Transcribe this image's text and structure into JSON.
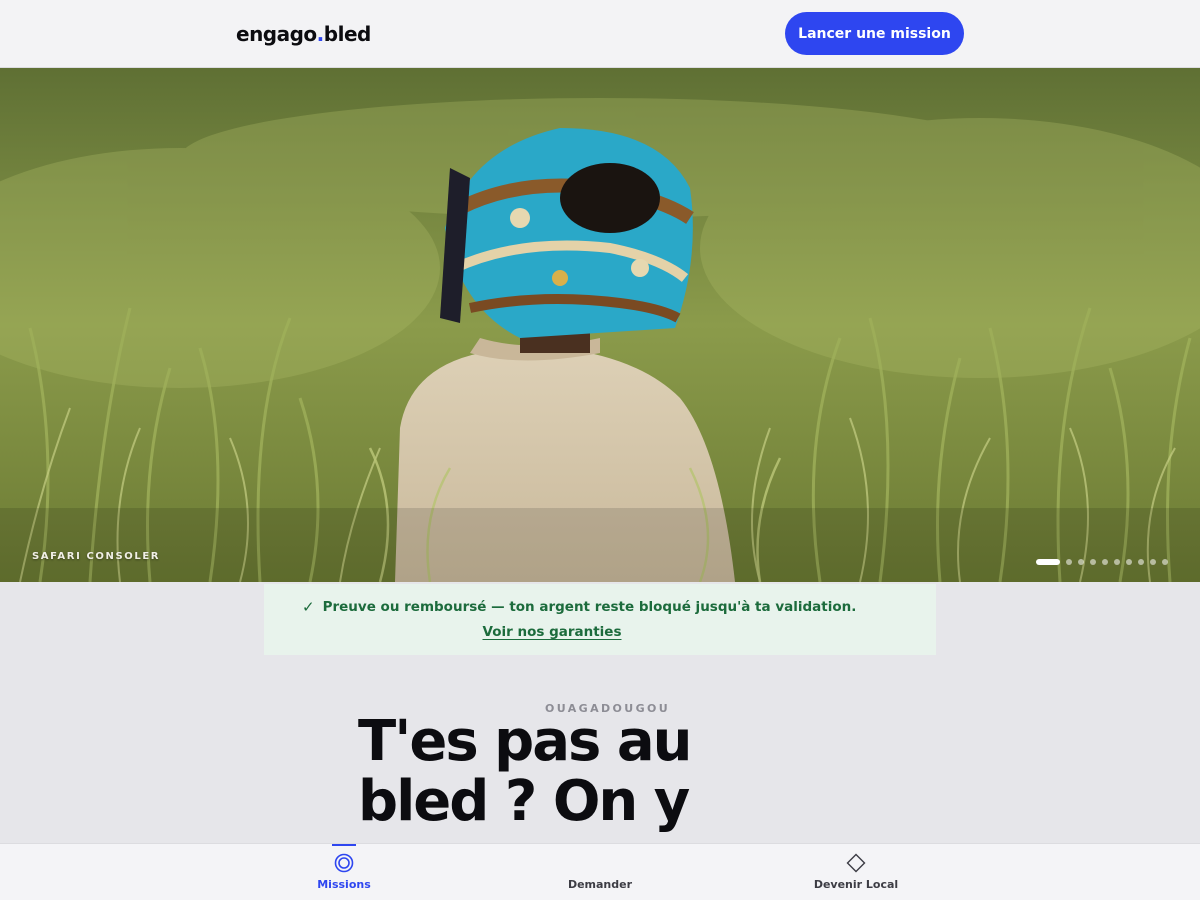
{
  "header": {
    "logo_main": "engago",
    "logo_dot": ".",
    "logo_suffix": "bled",
    "cta_label": "Lancer une mission"
  },
  "hero": {
    "caption": "SAFARI CONSOLER",
    "slide_count": 10,
    "active_slide": 1
  },
  "guarantee": {
    "text": "Preuve ou remboursé — ton argent reste bloqué jusqu'à ta validation.",
    "link_label": "Voir nos garanties"
  },
  "main": {
    "city": "OUAGADOUGOU",
    "headline_line1": "T'es pas au",
    "headline_line2": "bled ? On y"
  },
  "bottom_nav": {
    "items": [
      {
        "label": "Missions",
        "icon": "target-icon",
        "active": true
      },
      {
        "label": "Demander",
        "icon": "none",
        "active": false
      },
      {
        "label": "Devenir Local",
        "icon": "diamond-icon",
        "active": false
      }
    ]
  },
  "colors": {
    "accent": "#2e46f0",
    "success_text": "#1c6b3c",
    "success_bg": "#e8f3ec"
  }
}
